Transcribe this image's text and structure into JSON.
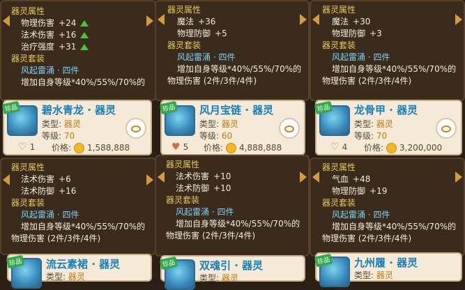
{
  "labels": {
    "attr_section": "器灵属性",
    "set_section": "器灵套装",
    "set_name": "风起雷涌 · 四件",
    "set_effect": "增加自身等级*40%/55%/70%的",
    "set_effect2": "物理伤害 (2件/3件/4件)",
    "type_label": "类型:",
    "level_label": "等级:",
    "price_label": "价格:",
    "tag": "珍品"
  },
  "top_left": {
    "attrs": [
      {
        "name": "物理伤害",
        "value": "+24"
      },
      {
        "name": "法术伤害",
        "value": "+16"
      },
      {
        "name": "治疗强度",
        "value": "+31"
      }
    ]
  },
  "top_mid": {
    "attrs": [
      {
        "name": "魔法",
        "value": "+36"
      },
      {
        "name": "物理防御",
        "value": "+5"
      }
    ]
  },
  "top_right": {
    "attrs": [
      {
        "name": "魔法",
        "value": "+30"
      },
      {
        "name": "物理防御",
        "value": "+3"
      }
    ]
  },
  "bottom_left": {
    "attrs": [
      {
        "name": "法术伤害",
        "value": "+6"
      },
      {
        "name": "法术防御",
        "value": "+16"
      }
    ]
  },
  "bottom_mid": {
    "attrs": [
      {
        "name": "法术伤害",
        "value": "+10"
      },
      {
        "name": "法术防御",
        "value": "+10"
      }
    ]
  },
  "bottom_right": {
    "attrs": [
      {
        "name": "气血",
        "value": "+48"
      },
      {
        "name": "物理防御",
        "value": "+19"
      }
    ]
  },
  "cards": [
    {
      "name": "碧水青龙 · 器灵",
      "type": "器灵",
      "level": "70",
      "likes": "1",
      "price": "1,588,888"
    },
    {
      "name": "风月宝链 · 器灵",
      "type": "器灵",
      "level": "60",
      "likes": "5",
      "price": "4,888,888"
    },
    {
      "name": "龙骨甲 · 器灵",
      "type": "器灵",
      "level": "70",
      "likes": "4",
      "price": "3,200,000"
    },
    {
      "name": "流云素裙 · 器灵",
      "type": "器灵"
    },
    {
      "name": "双魂引 · 器灵",
      "type": "器灵"
    },
    {
      "name": "九州履 · 器灵",
      "type": "器灵"
    }
  ]
}
